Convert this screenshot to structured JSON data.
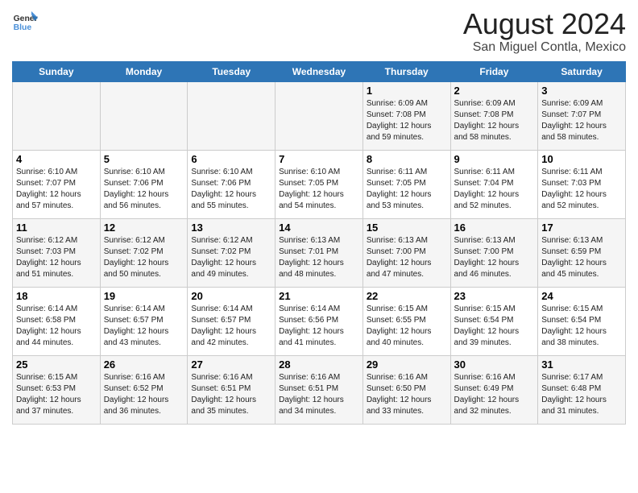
{
  "header": {
    "logo_line1": "General",
    "logo_line2": "Blue",
    "main_title": "August 2024",
    "subtitle": "San Miguel Contla, Mexico"
  },
  "days_of_week": [
    "Sunday",
    "Monday",
    "Tuesday",
    "Wednesday",
    "Thursday",
    "Friday",
    "Saturday"
  ],
  "weeks": [
    [
      {
        "day": "",
        "info": ""
      },
      {
        "day": "",
        "info": ""
      },
      {
        "day": "",
        "info": ""
      },
      {
        "day": "",
        "info": ""
      },
      {
        "day": "1",
        "info": "Sunrise: 6:09 AM\nSunset: 7:08 PM\nDaylight: 12 hours\nand 59 minutes."
      },
      {
        "day": "2",
        "info": "Sunrise: 6:09 AM\nSunset: 7:08 PM\nDaylight: 12 hours\nand 58 minutes."
      },
      {
        "day": "3",
        "info": "Sunrise: 6:09 AM\nSunset: 7:07 PM\nDaylight: 12 hours\nand 58 minutes."
      }
    ],
    [
      {
        "day": "4",
        "info": "Sunrise: 6:10 AM\nSunset: 7:07 PM\nDaylight: 12 hours\nand 57 minutes."
      },
      {
        "day": "5",
        "info": "Sunrise: 6:10 AM\nSunset: 7:06 PM\nDaylight: 12 hours\nand 56 minutes."
      },
      {
        "day": "6",
        "info": "Sunrise: 6:10 AM\nSunset: 7:06 PM\nDaylight: 12 hours\nand 55 minutes."
      },
      {
        "day": "7",
        "info": "Sunrise: 6:10 AM\nSunset: 7:05 PM\nDaylight: 12 hours\nand 54 minutes."
      },
      {
        "day": "8",
        "info": "Sunrise: 6:11 AM\nSunset: 7:05 PM\nDaylight: 12 hours\nand 53 minutes."
      },
      {
        "day": "9",
        "info": "Sunrise: 6:11 AM\nSunset: 7:04 PM\nDaylight: 12 hours\nand 52 minutes."
      },
      {
        "day": "10",
        "info": "Sunrise: 6:11 AM\nSunset: 7:03 PM\nDaylight: 12 hours\nand 52 minutes."
      }
    ],
    [
      {
        "day": "11",
        "info": "Sunrise: 6:12 AM\nSunset: 7:03 PM\nDaylight: 12 hours\nand 51 minutes."
      },
      {
        "day": "12",
        "info": "Sunrise: 6:12 AM\nSunset: 7:02 PM\nDaylight: 12 hours\nand 50 minutes."
      },
      {
        "day": "13",
        "info": "Sunrise: 6:12 AM\nSunset: 7:02 PM\nDaylight: 12 hours\nand 49 minutes."
      },
      {
        "day": "14",
        "info": "Sunrise: 6:13 AM\nSunset: 7:01 PM\nDaylight: 12 hours\nand 48 minutes."
      },
      {
        "day": "15",
        "info": "Sunrise: 6:13 AM\nSunset: 7:00 PM\nDaylight: 12 hours\nand 47 minutes."
      },
      {
        "day": "16",
        "info": "Sunrise: 6:13 AM\nSunset: 7:00 PM\nDaylight: 12 hours\nand 46 minutes."
      },
      {
        "day": "17",
        "info": "Sunrise: 6:13 AM\nSunset: 6:59 PM\nDaylight: 12 hours\nand 45 minutes."
      }
    ],
    [
      {
        "day": "18",
        "info": "Sunrise: 6:14 AM\nSunset: 6:58 PM\nDaylight: 12 hours\nand 44 minutes."
      },
      {
        "day": "19",
        "info": "Sunrise: 6:14 AM\nSunset: 6:57 PM\nDaylight: 12 hours\nand 43 minutes."
      },
      {
        "day": "20",
        "info": "Sunrise: 6:14 AM\nSunset: 6:57 PM\nDaylight: 12 hours\nand 42 minutes."
      },
      {
        "day": "21",
        "info": "Sunrise: 6:14 AM\nSunset: 6:56 PM\nDaylight: 12 hours\nand 41 minutes."
      },
      {
        "day": "22",
        "info": "Sunrise: 6:15 AM\nSunset: 6:55 PM\nDaylight: 12 hours\nand 40 minutes."
      },
      {
        "day": "23",
        "info": "Sunrise: 6:15 AM\nSunset: 6:54 PM\nDaylight: 12 hours\nand 39 minutes."
      },
      {
        "day": "24",
        "info": "Sunrise: 6:15 AM\nSunset: 6:54 PM\nDaylight: 12 hours\nand 38 minutes."
      }
    ],
    [
      {
        "day": "25",
        "info": "Sunrise: 6:15 AM\nSunset: 6:53 PM\nDaylight: 12 hours\nand 37 minutes."
      },
      {
        "day": "26",
        "info": "Sunrise: 6:16 AM\nSunset: 6:52 PM\nDaylight: 12 hours\nand 36 minutes."
      },
      {
        "day": "27",
        "info": "Sunrise: 6:16 AM\nSunset: 6:51 PM\nDaylight: 12 hours\nand 35 minutes."
      },
      {
        "day": "28",
        "info": "Sunrise: 6:16 AM\nSunset: 6:51 PM\nDaylight: 12 hours\nand 34 minutes."
      },
      {
        "day": "29",
        "info": "Sunrise: 6:16 AM\nSunset: 6:50 PM\nDaylight: 12 hours\nand 33 minutes."
      },
      {
        "day": "30",
        "info": "Sunrise: 6:16 AM\nSunset: 6:49 PM\nDaylight: 12 hours\nand 32 minutes."
      },
      {
        "day": "31",
        "info": "Sunrise: 6:17 AM\nSunset: 6:48 PM\nDaylight: 12 hours\nand 31 minutes."
      }
    ]
  ]
}
